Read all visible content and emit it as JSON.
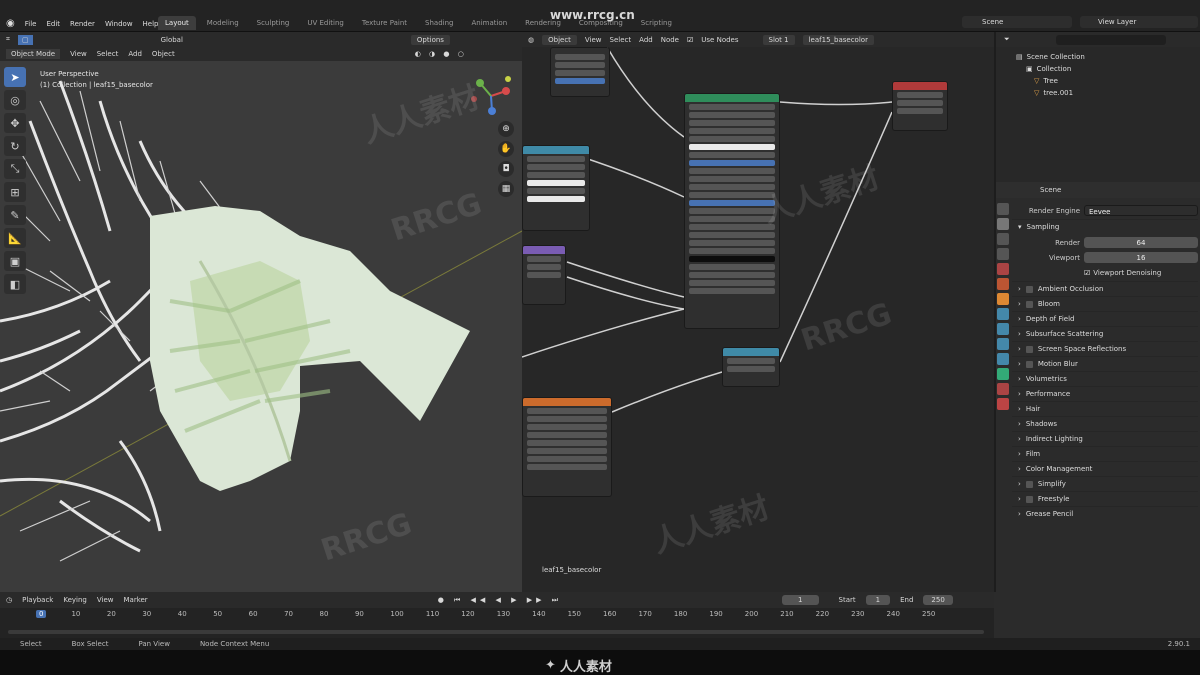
{
  "app": {
    "menu": [
      "File",
      "Edit",
      "Render",
      "Window",
      "Help"
    ],
    "workspace_tabs": [
      "Layout",
      "Modeling",
      "Sculpting",
      "UV Editing",
      "Texture Paint",
      "Shading",
      "Animation",
      "Rendering",
      "Compositing",
      "Scripting"
    ],
    "active_tab": "Layout",
    "scene": "Scene",
    "view_layer": "View Layer"
  },
  "viewport": {
    "mode": "Object Mode",
    "menus": [
      "View",
      "Select",
      "Add",
      "Object"
    ],
    "transform": "Global",
    "options": "Options",
    "info_line1": "User Perspective",
    "info_line2": "(1) Collection | leaf15_basecolor"
  },
  "node_editor": {
    "type": "Object",
    "menus": [
      "View",
      "Select",
      "Add",
      "Node"
    ],
    "use_nodes": "Use Nodes",
    "slot": "Slot 1",
    "material": "leaf15_basecolor",
    "footer_label": "leaf15_basecolor",
    "colors": {
      "principled": "#2f8d5b",
      "output": "#b03a3a",
      "texture": "#3f8aa7",
      "tex_image": "#cc6b2c",
      "mix": "#7a5cb3"
    }
  },
  "outliner": {
    "root": "Scene Collection",
    "items": [
      "Collection",
      "Tree",
      "tree.001"
    ]
  },
  "properties": {
    "scene_label": "Scene",
    "render_engine_label": "Render Engine",
    "render_engine": "Eevee",
    "sampling_label": "Sampling",
    "render_label": "Render",
    "render_value": "64",
    "viewport_label": "Viewport",
    "viewport_value": "16",
    "denoise_label": "Viewport Denoising",
    "sections": [
      {
        "name": "Ambient Occlusion",
        "checkbox": true
      },
      {
        "name": "Bloom",
        "checkbox": true
      },
      {
        "name": "Depth of Field",
        "checkbox": false
      },
      {
        "name": "Subsurface Scattering",
        "checkbox": false
      },
      {
        "name": "Screen Space Reflections",
        "checkbox": true
      },
      {
        "name": "Motion Blur",
        "checkbox": true
      },
      {
        "name": "Volumetrics",
        "checkbox": false
      },
      {
        "name": "Performance",
        "checkbox": false
      },
      {
        "name": "Hair",
        "checkbox": false
      },
      {
        "name": "Shadows",
        "checkbox": false
      },
      {
        "name": "Indirect Lighting",
        "checkbox": false
      },
      {
        "name": "Film",
        "checkbox": false
      },
      {
        "name": "Color Management",
        "checkbox": false
      },
      {
        "name": "Simplify",
        "checkbox": true
      },
      {
        "name": "Freestyle",
        "checkbox": true
      },
      {
        "name": "Grease Pencil",
        "checkbox": false
      }
    ]
  },
  "timeline": {
    "menus": [
      "Playback",
      "Keying",
      "View",
      "Marker"
    ],
    "current_frame": "1",
    "start_label": "Start",
    "start": "1",
    "end_label": "End",
    "end": "250",
    "ticks": [
      "0",
      "10",
      "20",
      "30",
      "40",
      "50",
      "60",
      "70",
      "80",
      "90",
      "100",
      "110",
      "120",
      "130",
      "140",
      "150",
      "160",
      "170",
      "180",
      "190",
      "200",
      "210",
      "220",
      "230",
      "240",
      "250"
    ]
  },
  "status": {
    "items": [
      "Select",
      "Box Select",
      "Pan View",
      "Node Context Menu"
    ],
    "version": "2.90.1"
  },
  "branding": {
    "site": "www.rrcg.cn",
    "bottom_logo": "人人素材",
    "watermark_a": "RRCG",
    "watermark_b": "人人素材"
  }
}
